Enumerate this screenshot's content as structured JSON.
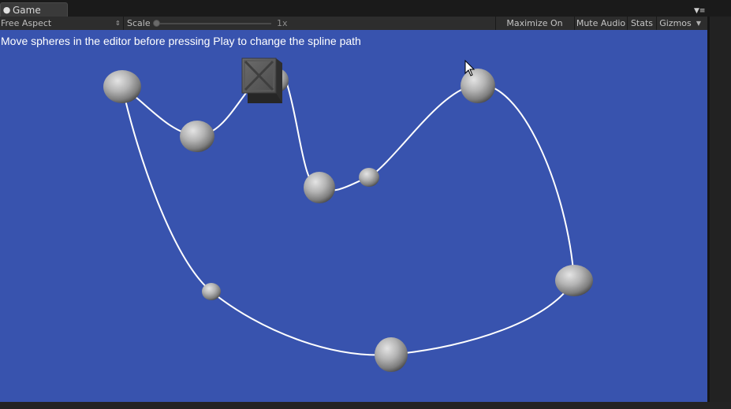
{
  "window": {
    "tab_icon": "pac-man-icon",
    "tab_title": "Game",
    "panel_menu_icon": "panel-menu-icon"
  },
  "toolbar": {
    "aspect": "Free Aspect",
    "scale_label": "Scale",
    "scale_value": "1x",
    "maximize_on_play": "Maximize On Play",
    "mute_audio": "Mute Audio",
    "stats": "Stats",
    "gizmos": "Gizmos"
  },
  "viewport": {
    "instruction": "Move spheres in the editor before pressing Play to change the spline path",
    "background_color": "#3853ae",
    "spline_color": "#ffffff",
    "sphere_color": "#b4b4b4",
    "cube_icon": "crate-icon",
    "cursor_icon": "mouse-cursor-icon"
  }
}
